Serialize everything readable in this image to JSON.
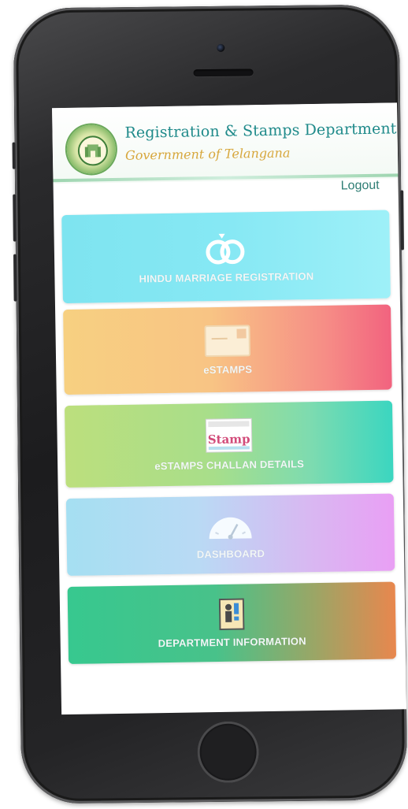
{
  "header": {
    "title": "Registration & Stamps Department",
    "subtitle": "Government of Telangana",
    "logout_label": "Logout"
  },
  "menu": [
    {
      "label": "HINDU MARRIAGE REGISTRATION",
      "icon": "rings-icon"
    },
    {
      "label": "eSTAMPS",
      "icon": "envelope-icon"
    },
    {
      "label": "eSTAMPS CHALLAN DETAILS",
      "icon": "challan-stamp-icon",
      "icon_text": "Stamp"
    },
    {
      "label": "DASHBOARD",
      "icon": "speedometer-icon"
    },
    {
      "label": "DEPARTMENT INFORMATION",
      "icon": "info-person-icon"
    }
  ],
  "colors": {
    "title": "#1f8a8a",
    "subtitle": "#d7a73c",
    "logout": "#2e7d74",
    "tile_text": "#f2f7f7"
  }
}
